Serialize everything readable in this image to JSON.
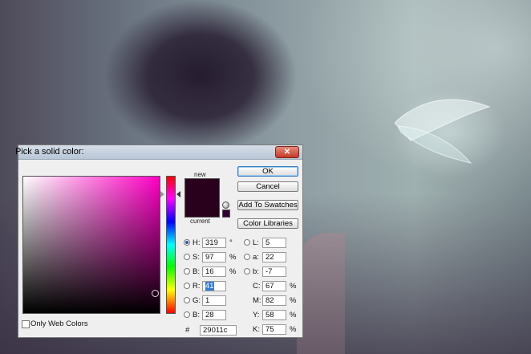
{
  "dialog": {
    "title": "Pick a solid color:",
    "close_label": "✕",
    "new_label": "new",
    "current_label": "current",
    "new_color": "#29011c",
    "current_color": "#29011c",
    "buttons": {
      "ok": "OK",
      "cancel": "Cancel",
      "add_swatches": "Add To Swatches",
      "color_libraries": "Color Libraries"
    },
    "hsb": [
      {
        "label": "H:",
        "value": "319",
        "unit": "°",
        "selected": true
      },
      {
        "label": "S:",
        "value": "97",
        "unit": "%",
        "selected": false
      },
      {
        "label": "B:",
        "value": "16",
        "unit": "%",
        "selected": false
      }
    ],
    "rgb": [
      {
        "label": "R:",
        "value": "41",
        "selected": false,
        "highlighted": true
      },
      {
        "label": "G:",
        "value": "1",
        "selected": false,
        "highlighted": false
      },
      {
        "label": "B:",
        "value": "28",
        "selected": false,
        "highlighted": false
      }
    ],
    "lab": [
      {
        "label": "L:",
        "value": "5"
      },
      {
        "label": "a:",
        "value": "22"
      },
      {
        "label": "b:",
        "value": "-7"
      }
    ],
    "cmyk": [
      {
        "label": "C:",
        "value": "67",
        "unit": "%"
      },
      {
        "label": "M:",
        "value": "82",
        "unit": "%"
      },
      {
        "label": "Y:",
        "value": "58",
        "unit": "%"
      },
      {
        "label": "K:",
        "value": "75",
        "unit": "%"
      }
    ],
    "hex_label": "#",
    "hex_value": "29011c",
    "only_web_colors_label": "Only Web Colors",
    "only_web_colors_checked": false,
    "field_hue_color": "#ff00c4"
  }
}
